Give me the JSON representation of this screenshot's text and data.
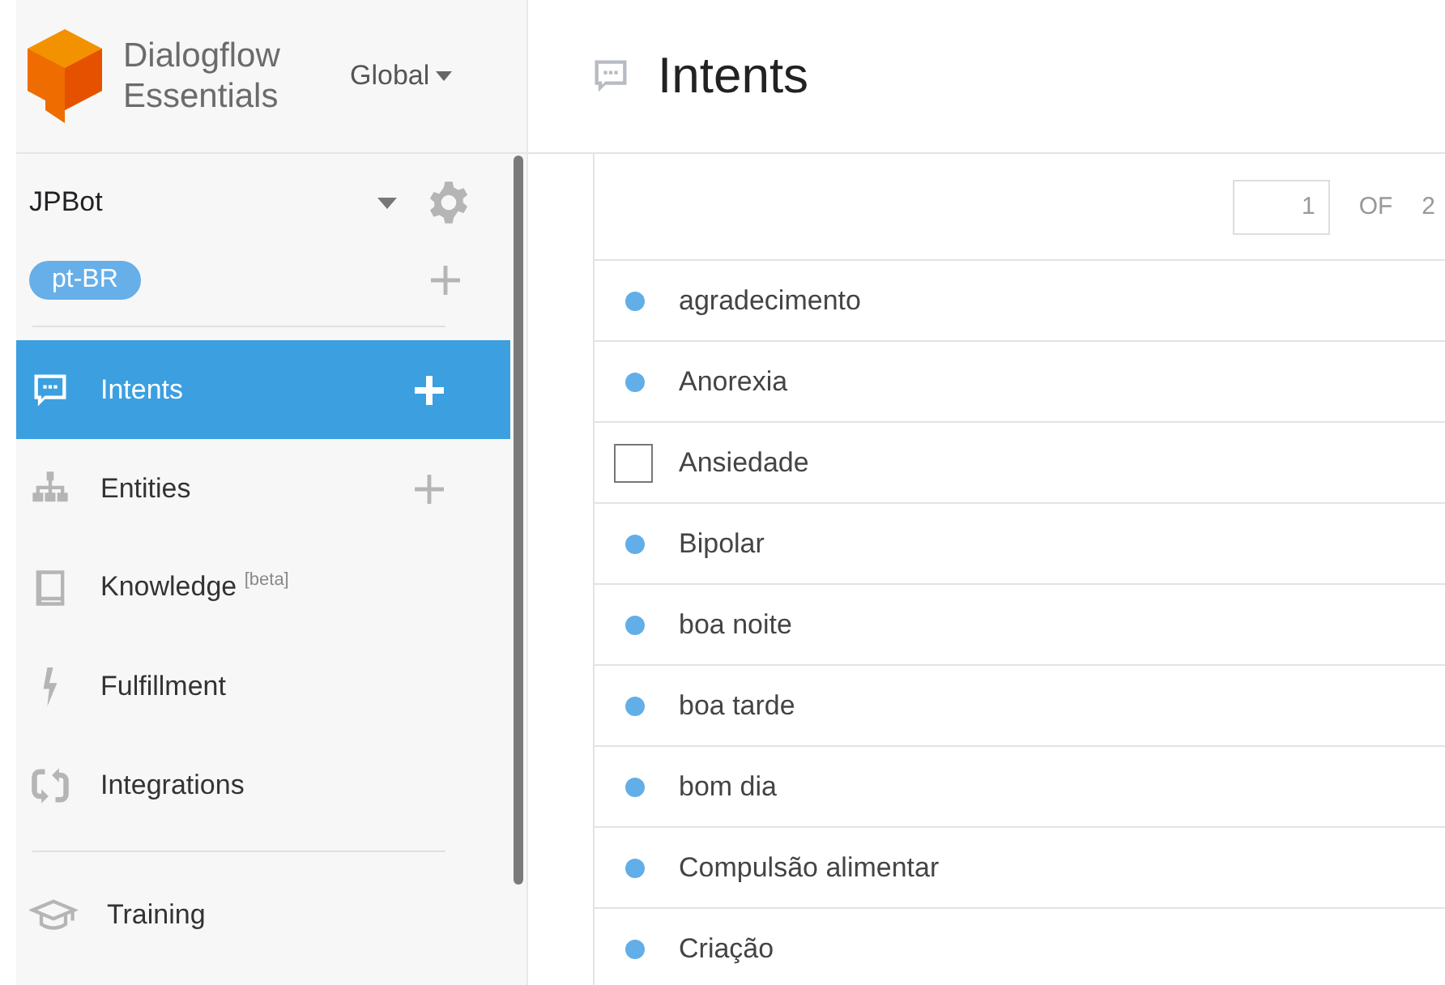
{
  "brand": {
    "line1": "Dialogflow",
    "line2": "Essentials",
    "region": "Global"
  },
  "agent": {
    "name": "JPBot",
    "language": "pt-BR"
  },
  "nav": [
    {
      "label": "Intents",
      "selected": true,
      "add": true
    },
    {
      "label": "Entities",
      "selected": false,
      "add": true
    },
    {
      "label": "Knowledge $^{[beta]}$",
      "selected": false,
      "add": false
    },
    {
      "label": "Fulfillment",
      "selected": false,
      "add": false
    },
    {
      "label": "Integrations",
      "selected": false,
      "add": false
    }
  ],
  "nav_secondary": [
    {
      "label": "Training",
      "selected": false,
      "add": false
    }
  ],
  "page": {
    "title": "Intents"
  },
  "pager": {
    "page": "1",
    "of": "OF",
    "total": "2"
  },
  "intents": [
    {
      "name": "agradecimento",
      "kind": "dot"
    },
    {
      "name": "Anorexia",
      "kind": "dot"
    },
    {
      "name": "Ansiedade",
      "kind": "checkbox",
      "checked": false
    },
    {
      "name": "Bipolar",
      "kind": "dot"
    },
    {
      "name": "boa noite",
      "kind": "dot"
    },
    {
      "name": "boa tarde",
      "kind": "dot"
    },
    {
      "name": "bom dia",
      "kind": "dot"
    },
    {
      "name": "Compulsão alimentar",
      "kind": "dot"
    },
    {
      "name": "Criação",
      "kind": "dot"
    }
  ]
}
